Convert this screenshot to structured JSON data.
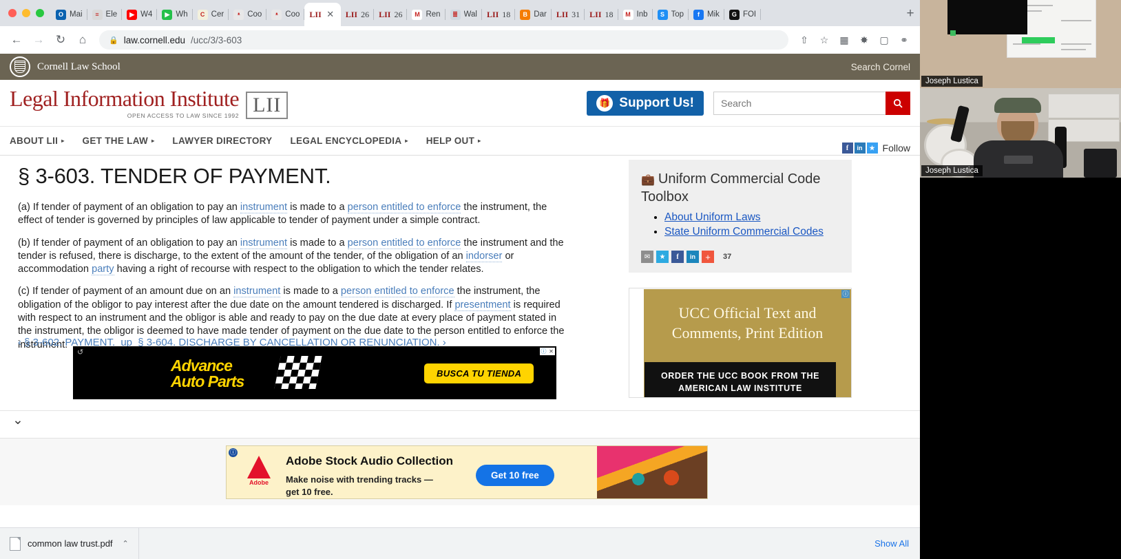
{
  "browser": {
    "tabs": [
      {
        "label": "Mai",
        "icon": "outlook-icon",
        "color": "#0a62b0",
        "glyph": "O",
        "active": false
      },
      {
        "label": "Ele",
        "icon": "generic-icon",
        "color": "#d9d9d9",
        "glyph": "≡",
        "active": false
      },
      {
        "label": "W4",
        "icon": "youtube-icon",
        "color": "#ff0000",
        "glyph": "▶",
        "active": false
      },
      {
        "label": "Wh",
        "icon": "play-icon",
        "color": "#24c04a",
        "glyph": "▶",
        "active": false
      },
      {
        "label": "Cer",
        "icon": "doc-icon",
        "color": "#f3f0dc",
        "glyph": "C",
        "active": false
      },
      {
        "label": "Coo",
        "icon": "chart-icon",
        "color": "#e8e8e8",
        "glyph": "ᵜ",
        "active": false
      },
      {
        "label": "Coo",
        "icon": "chart-icon",
        "color": "#e8e8e8",
        "glyph": "ᵜ",
        "active": false
      },
      {
        "label": "LII",
        "icon": "lii-icon",
        "color": "transparent",
        "glyph": "",
        "active": true
      },
      {
        "label": "26",
        "icon": "lii-icon",
        "color": "transparent",
        "glyph": "",
        "active": false
      },
      {
        "label": "26",
        "icon": "lii-icon",
        "color": "transparent",
        "glyph": "",
        "active": false
      },
      {
        "label": "Ren",
        "icon": "gmail-icon",
        "color": "#ffffff",
        "glyph": "M",
        "active": false
      },
      {
        "label": "Wal",
        "icon": "layers-icon",
        "color": "#cfd8e0",
        "glyph": "≣",
        "active": false
      },
      {
        "label": "18",
        "icon": "lii-icon",
        "color": "transparent",
        "glyph": "",
        "active": false
      },
      {
        "label": "Dar",
        "icon": "blogger-icon",
        "color": "#f57d00",
        "glyph": "B",
        "active": false
      },
      {
        "label": "31",
        "icon": "lii-icon",
        "color": "transparent",
        "glyph": "",
        "active": false
      },
      {
        "label": "18",
        "icon": "lii-icon",
        "color": "transparent",
        "glyph": "",
        "active": false
      },
      {
        "label": "Inb",
        "icon": "gmail-icon",
        "color": "#ffffff",
        "glyph": "M",
        "active": false
      },
      {
        "label": "Top",
        "icon": "app-icon",
        "color": "#1f8ff5",
        "glyph": "S",
        "active": false
      },
      {
        "label": "Mik",
        "icon": "facebook-icon",
        "color": "#1877f2",
        "glyph": "f",
        "active": false
      },
      {
        "label": "FOI",
        "icon": "grammarly-icon",
        "color": "#111111",
        "glyph": "G",
        "active": false
      }
    ],
    "lii_tab_prefix": "LII",
    "new_tab_label": "+",
    "close_tab_label": "✕",
    "nav": {
      "back": "←",
      "forward": "→",
      "reload": "↻",
      "home": "⌂"
    },
    "url_domain": "law.cornell.edu",
    "url_path": "/ucc/3/3-603",
    "lock_glyph": "ὑ2",
    "toolbar_icons": [
      "share-icon",
      "bookmark-star-icon",
      "reading-list-icon",
      "extensions-puzzle-icon",
      "sidebar-icon",
      "profile-icon"
    ]
  },
  "cornell": {
    "school_name": "Cornell Law School",
    "search_label": "Search Cornel"
  },
  "masthead": {
    "title": "Legal Information Institute",
    "tagline": "OPEN ACCESS TO LAW SINCE 1992",
    "badge": "LII",
    "support_label": "Support Us!",
    "search_placeholder": "Search",
    "search_value": ""
  },
  "mainnav": {
    "items": [
      {
        "label": "ABOUT LII",
        "caret": true
      },
      {
        "label": "GET THE LAW",
        "caret": true
      },
      {
        "label": "LAWYER DIRECTORY",
        "caret": false
      },
      {
        "label": "LEGAL ENCYCLOPEDIA",
        "caret": true
      },
      {
        "label": "HELP OUT",
        "caret": true
      }
    ],
    "follow_label": "Follow",
    "social": [
      "facebook-icon",
      "linkedin-icon",
      "twitter-icon"
    ]
  },
  "article": {
    "title": "§ 3-603. TENDER OF PAYMENT.",
    "paragraphs": [
      {
        "id": "a",
        "runs": [
          {
            "t": "(a) If tender of payment of an obligation to pay an ",
            "link": false
          },
          {
            "t": "instrument",
            "link": true
          },
          {
            "t": " is made to a ",
            "link": false
          },
          {
            "t": "person entitled to enforce",
            "link": true
          },
          {
            "t": " the instrument, the effect of tender is governed by principles of law applicable to tender of payment under a simple contract.",
            "link": false
          }
        ]
      },
      {
        "id": "b",
        "runs": [
          {
            "t": "(b) If tender of payment of an obligation to pay an ",
            "link": false
          },
          {
            "t": "instrument",
            "link": true
          },
          {
            "t": " is made to a ",
            "link": false
          },
          {
            "t": "person entitled to enforce",
            "link": true
          },
          {
            "t": " the instrument and the tender is refused, there is discharge, to the extent of the amount of the tender, of the obligation of an ",
            "link": false
          },
          {
            "t": "indorser",
            "link": true
          },
          {
            "t": " or accommodation ",
            "link": false
          },
          {
            "t": "party",
            "link": true
          },
          {
            "t": " having a right of recourse with respect to the obligation to which the tender relates.",
            "link": false
          }
        ]
      },
      {
        "id": "c",
        "runs": [
          {
            "t": "(c) If tender of payment of an amount due on an ",
            "link": false
          },
          {
            "t": "instrument",
            "link": true
          },
          {
            "t": " is made to a ",
            "link": false
          },
          {
            "t": "person entitled to enforce",
            "link": true
          },
          {
            "t": " the instrument, the obligation of the obligor to pay interest after the due date on the amount tendered is discharged. If ",
            "link": false
          },
          {
            "t": "presentment",
            "link": true
          },
          {
            "t": " is required with respect to an instrument and the obligor is able and ready to pay on the due date at every place of payment stated in the instrument, the obligor is deemed to have made tender of payment on the due date to the person entitled to enforce the instrument.",
            "link": false
          }
        ]
      }
    ],
    "prev_label": "‹ § 3-602. PAYMENT.",
    "up_label": "up",
    "next_label": "§ 3-604. DISCHARGE BY CANCELLATION OR RENUNCIATION. ›"
  },
  "sidebar": {
    "toolbox_icon": "briefcase-icon",
    "toolbox_title": "Uniform Commercial Code Toolbox",
    "links": [
      "About Uniform Laws",
      "State Uniform Commercial Codes"
    ],
    "share_icons": [
      "email-icon",
      "twitter-icon",
      "facebook-icon",
      "linkedin-icon",
      "addthis-plus-icon"
    ],
    "share_count": "37",
    "ad": {
      "adchoices": "ⓘ",
      "headline_line1": "UCC Official Text and",
      "headline_line2": "Comments, Print Edition",
      "cta_line1": "ORDER THE UCC BOOK FROM THE",
      "cta_line2": "AMERICAN LAW INSTITUTE"
    }
  },
  "banner_ad": {
    "refresh_glyph": "↺",
    "brand_line1": "Advance",
    "brand_line2": "Auto Parts",
    "cta": "BUSCA TU TIENDA",
    "adchoices_i": "ⓘ",
    "adchoices_x": "✕"
  },
  "adobe_ad": {
    "info_glyph": "ⓘ",
    "adchoices_i": "ⓘ",
    "adchoices_x": "✕",
    "brand": "Adobe",
    "title": "Adobe Stock Audio Collection",
    "sub_line1": "Make noise with trending tracks —",
    "sub_line2": "get 10 free.",
    "cta": "Get 10 free"
  },
  "collapse": {
    "chevron": "⌄"
  },
  "downloads": {
    "file_name": "common law trust.pdf",
    "file_icon": "pdf-file-icon",
    "menu_caret": "⌃",
    "show_all": "Show All"
  },
  "video": {
    "top_name": "Joseph Lustica",
    "bottom_name": "Joseph Lustica"
  }
}
